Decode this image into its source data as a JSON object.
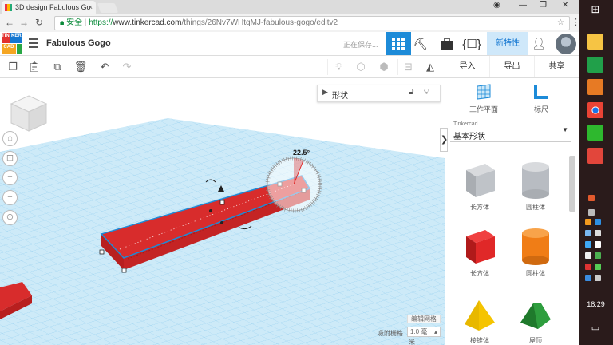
{
  "browser": {
    "tab_title": "3D design Fabulous Go",
    "tab_close": "×",
    "url_secure_label": "安全",
    "url_scheme": "https://",
    "url_host": "www.tinkercad.com",
    "url_path": "/things/26Nv7WHtqMJ-fabulous-gogo/editv2",
    "window_controls": [
      "—",
      "❐",
      "✕"
    ]
  },
  "header": {
    "logo_letters": [
      "TIN",
      "KER",
      "CAD"
    ],
    "design_name": "Fabulous Gogo",
    "saving_status": "正在保存...",
    "new_features_label": "新特性"
  },
  "edit_bar": {
    "import_label": "导入",
    "export_label": "导出",
    "share_label": "共享"
  },
  "workplane": {
    "shape_panel_label": "形状",
    "rotation_angle": "22.5°",
    "edit_grid_label": "编辑网格",
    "snap_grid_label": "吸附栅格",
    "snap_grid_value": "1.0 毫",
    "snap_grid_unit": "米",
    "view_controls": [
      "⌂",
      "⊡",
      "+",
      "−",
      "⊙"
    ]
  },
  "sidebar": {
    "workplane_tool_label": "工作平面",
    "ruler_tool_label": "标尺",
    "library_category": "Tinkercad",
    "library_name": "基本形状",
    "shapes": [
      {
        "label": "长方体",
        "color": "#b8bcc2"
      },
      {
        "label": "圆柱体",
        "color": "#b8bcc2"
      },
      {
        "label": "长方体",
        "color": "#e02828"
      },
      {
        "label": "圆柱体",
        "color": "#f07d16"
      },
      {
        "label": "棱锥体",
        "color": "#f5c400"
      },
      {
        "label": "屋顶",
        "color": "#2e9e3e"
      }
    ]
  },
  "taskbar": {
    "clock": "18:29"
  },
  "colors": {
    "accent": "#1d8bd8",
    "selected_shape": "#e03a3a",
    "grid_blue": "#9fd4f0"
  }
}
